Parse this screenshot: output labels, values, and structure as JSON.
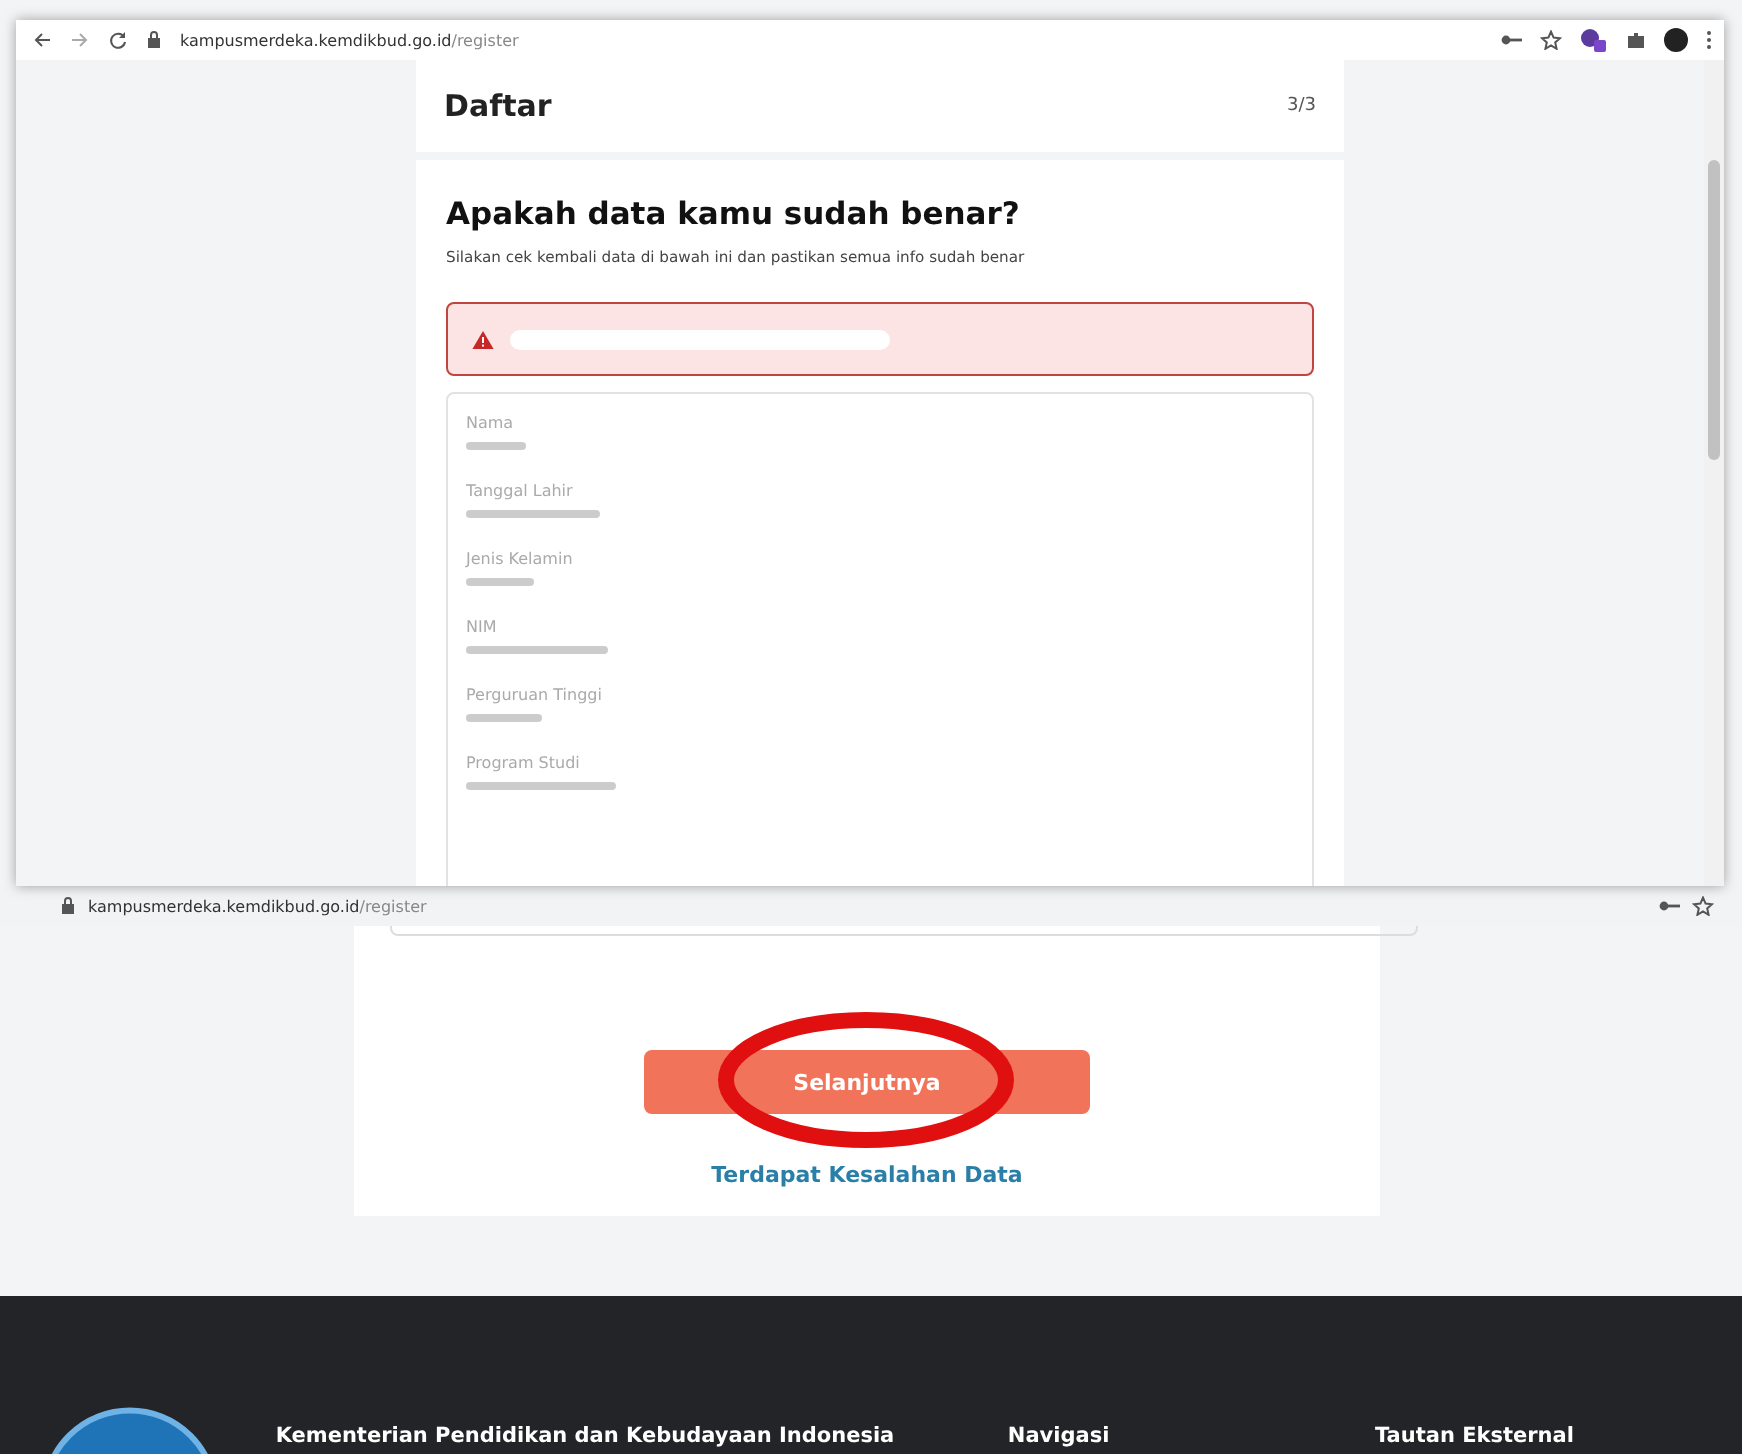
{
  "front_window": {
    "address_bar": {
      "host": "kampusmerdeka.kemdikbud.go.id",
      "path": "/register"
    },
    "header": {
      "title": "Daftar",
      "step": "3/3"
    },
    "review": {
      "heading": "Apakah data kamu sudah benar?",
      "subtitle": "Silakan cek kembali data di bawah ini dan pastikan semua info sudah benar",
      "fields": [
        {
          "label": "Nama"
        },
        {
          "label": "Tanggal Lahir"
        },
        {
          "label": "Jenis Kelamin"
        },
        {
          "label": "NIM"
        },
        {
          "label": "Perguruan Tinggi"
        },
        {
          "label": "Program Studi"
        }
      ]
    }
  },
  "back_page": {
    "address_bar": {
      "host": "kampusmerdeka.kemdikbud.go.id",
      "path": "/register"
    },
    "primary_button": "Selanjutnya",
    "secondary_link": "Terdapat Kesalahan Data"
  },
  "footer": {
    "organization": "Kementerian Pendidikan dan Kebudayaan Indonesia",
    "columns": [
      "Navigasi",
      "Tautan Eksternal"
    ]
  }
}
